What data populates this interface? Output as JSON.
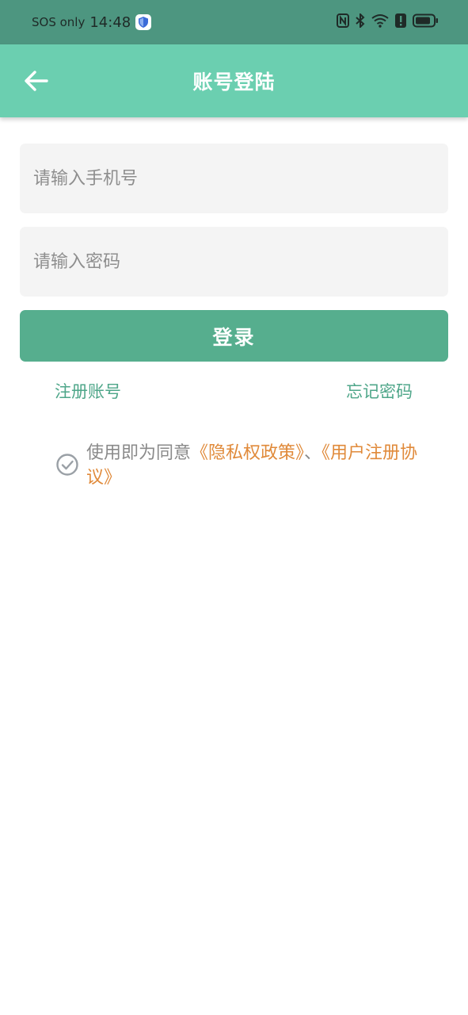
{
  "status_bar": {
    "sos": "SOS only",
    "time": "14:48",
    "icons": [
      "shield-icon",
      "nfc-icon",
      "bluetooth-icon",
      "wifi-icon",
      "alert-icon",
      "battery-icon"
    ]
  },
  "app_bar": {
    "title": "账号登陆",
    "back_icon": "arrow-left-icon"
  },
  "form": {
    "phone_placeholder": "请输入手机号",
    "phone_value": "",
    "password_placeholder": "请输入密码",
    "password_value": "",
    "login_label": "登录"
  },
  "links": {
    "register": "注册账号",
    "forgot": "忘记密码"
  },
  "agreement": {
    "prefix": "使用即为同意",
    "privacy": "《隐私权政策》",
    "separator": "、",
    "terms": "《用户注册协议》",
    "check_icon": "check-circle-icon"
  },
  "colors": {
    "status_bar": "#4d9680",
    "app_bar": "#6bcfb0",
    "primary": "#56ae8e",
    "link": "#4ea689",
    "policy_link": "#e08a3a"
  }
}
